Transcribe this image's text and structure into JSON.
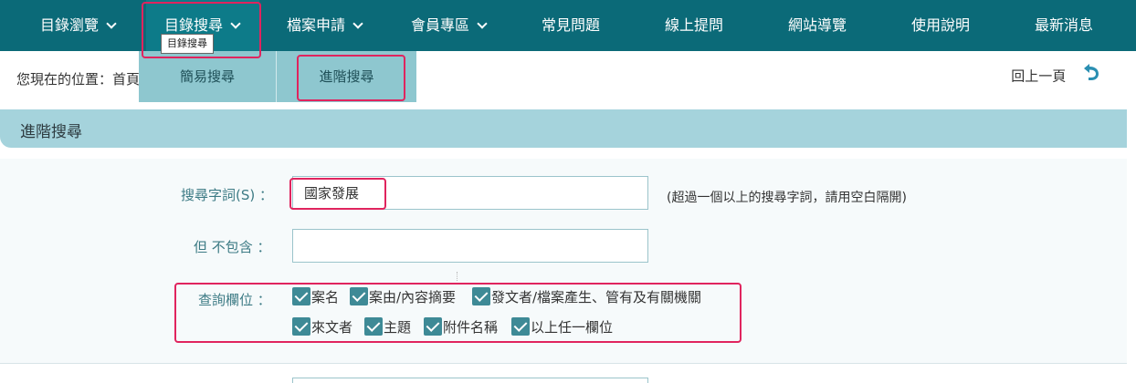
{
  "nav": {
    "items": [
      {
        "label": "目錄瀏覽",
        "dropdown": true
      },
      {
        "label": "目錄搜尋",
        "dropdown": true
      },
      {
        "label": "檔案申請",
        "dropdown": true
      },
      {
        "label": "會員專區",
        "dropdown": true
      },
      {
        "label": "常見問題",
        "dropdown": false
      },
      {
        "label": "線上提問",
        "dropdown": false
      },
      {
        "label": "網站導覽",
        "dropdown": false
      },
      {
        "label": "使用說明",
        "dropdown": false
      },
      {
        "label": "最新消息",
        "dropdown": false
      }
    ],
    "tooltip": "目錄搜尋",
    "submenu": [
      "簡易搜尋",
      "進階搜尋"
    ]
  },
  "breadcrumb": {
    "prefix": "您現在的位置：",
    "home": "首頁"
  },
  "back": {
    "label": "回上一頁",
    "icon": "back-arrow-icon"
  },
  "section": {
    "title": "進階搜尋"
  },
  "form": {
    "search_label": "搜尋字詞(S) ：",
    "search_value": "國家發展",
    "exclude_label": "但 不包含 ：",
    "exclude_value": "",
    "hint": "(超過一個以上的搜尋字詞，請用空白隔開)",
    "fields_label": "查詢欄位 ：",
    "checkboxes": [
      {
        "label": "案名",
        "checked": true
      },
      {
        "label": "案由/內容摘要",
        "checked": true
      },
      {
        "label": "發文者/檔案產生、管有及有關機關",
        "checked": true
      },
      {
        "label": "來文者",
        "checked": true
      },
      {
        "label": "主題",
        "checked": true
      },
      {
        "label": "附件名稱",
        "checked": true
      },
      {
        "label": "以上任一欄位",
        "checked": true
      }
    ]
  },
  "colors": {
    "nav_bg": "#0b6a78",
    "submenu_bg": "#8ec7cf",
    "section_bg": "#a5d3dc",
    "checkbox": "#3e8a96",
    "highlight": "#e0245e"
  }
}
